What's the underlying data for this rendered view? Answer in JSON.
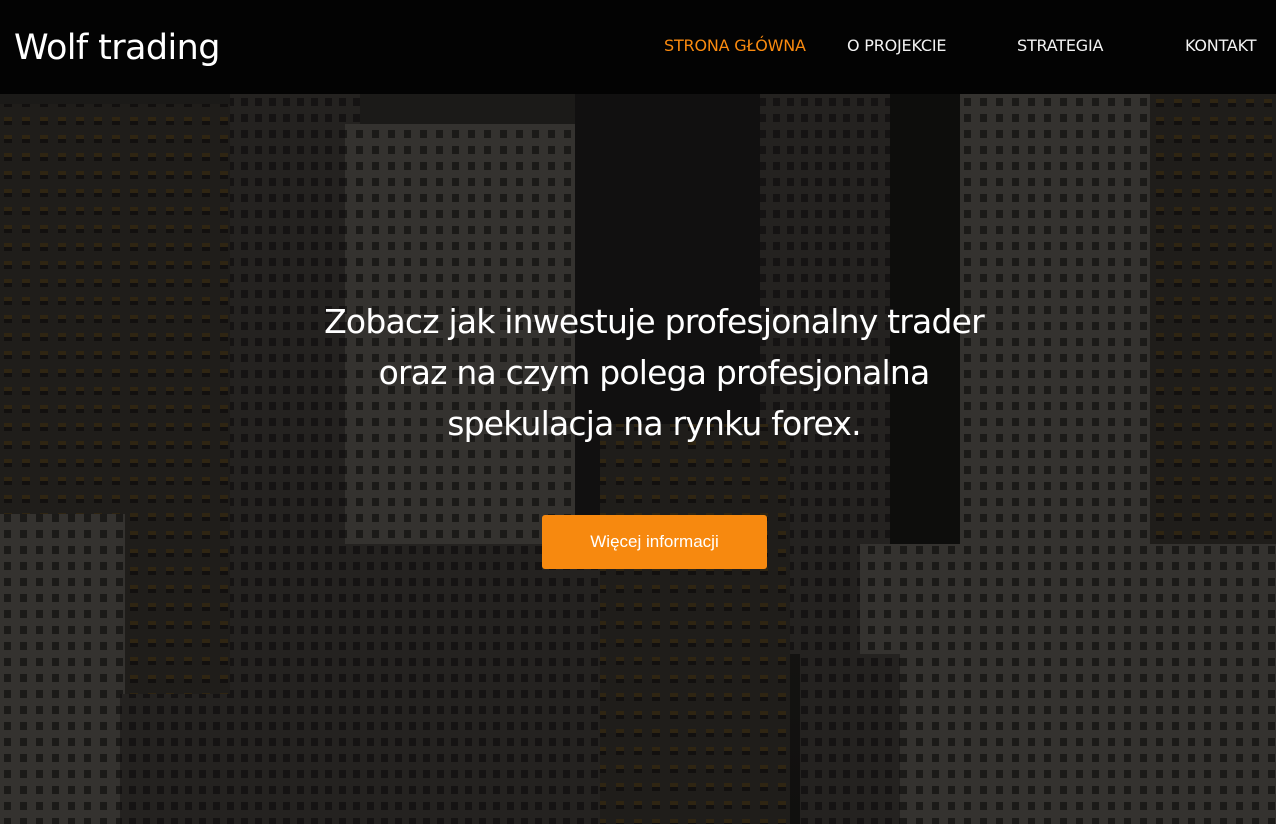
{
  "nav": {
    "brand": "Wolf trading",
    "links": [
      {
        "label": "STRONA GŁÓWNA",
        "active": true
      },
      {
        "label": "O PROJEKCIE",
        "active": false
      },
      {
        "label": "STRATEGIA",
        "active": false
      },
      {
        "label": "KONTAKT",
        "active": false
      }
    ]
  },
  "hero": {
    "headline_lines": [
      "Zobacz jak inwestuje profesjonalny trader",
      "oraz na czym polega profesjonalna",
      "spekulacja na rynku forex."
    ],
    "cta_label": "Więcej informacji"
  },
  "colors": {
    "accent": "#f7890f",
    "nav_active": "#fa8a0f",
    "navbar_bg": "#030303"
  }
}
